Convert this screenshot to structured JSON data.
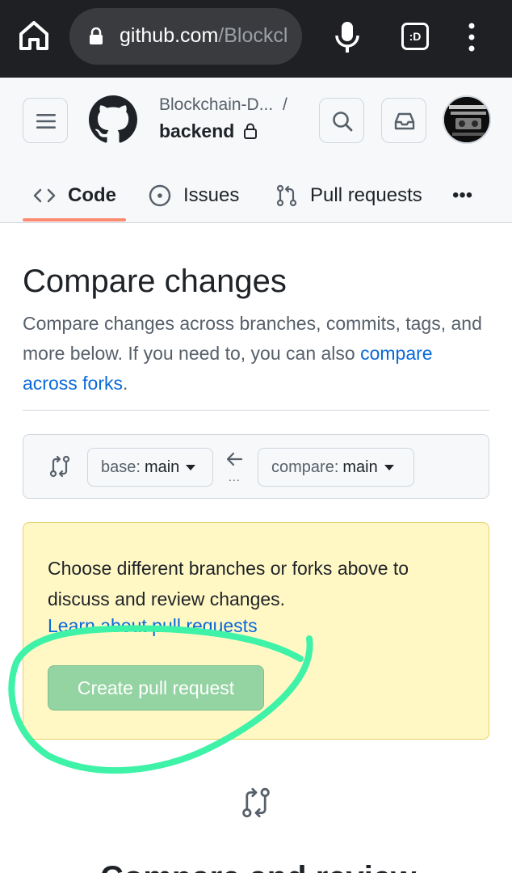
{
  "browser": {
    "url_host": "github.com",
    "url_path": "/Blockcl",
    "tabs_label": ":D"
  },
  "header": {
    "repo_owner": "Blockchain-D...",
    "separator": "/",
    "repo_name": "backend",
    "nav": [
      {
        "label": "Code"
      },
      {
        "label": "Issues"
      },
      {
        "label": "Pull requests"
      }
    ],
    "more_label": "•••"
  },
  "main": {
    "title": "Compare changes",
    "description": "Compare changes across branches, commits, tags, and more below. If you need to, you can also",
    "forks_link": "compare across forks",
    "forks_link_suffix": ".",
    "base_prefix": "base:",
    "base_value": "main",
    "compare_prefix": "compare:",
    "compare_value": "main",
    "dots": "...",
    "flash_text": "Choose different branches or forks above to discuss and review changes.",
    "flash_link": "Learn about pull requests",
    "create_button": "Create pull request",
    "bottom_heading": "Compare and review"
  },
  "colors": {
    "accent_underline": "#fd8c73",
    "link": "#0969da",
    "flash_bg": "#fff8c5",
    "create_button_bg": "#94d3a2",
    "annotation_stroke": "#3ef2a7"
  }
}
